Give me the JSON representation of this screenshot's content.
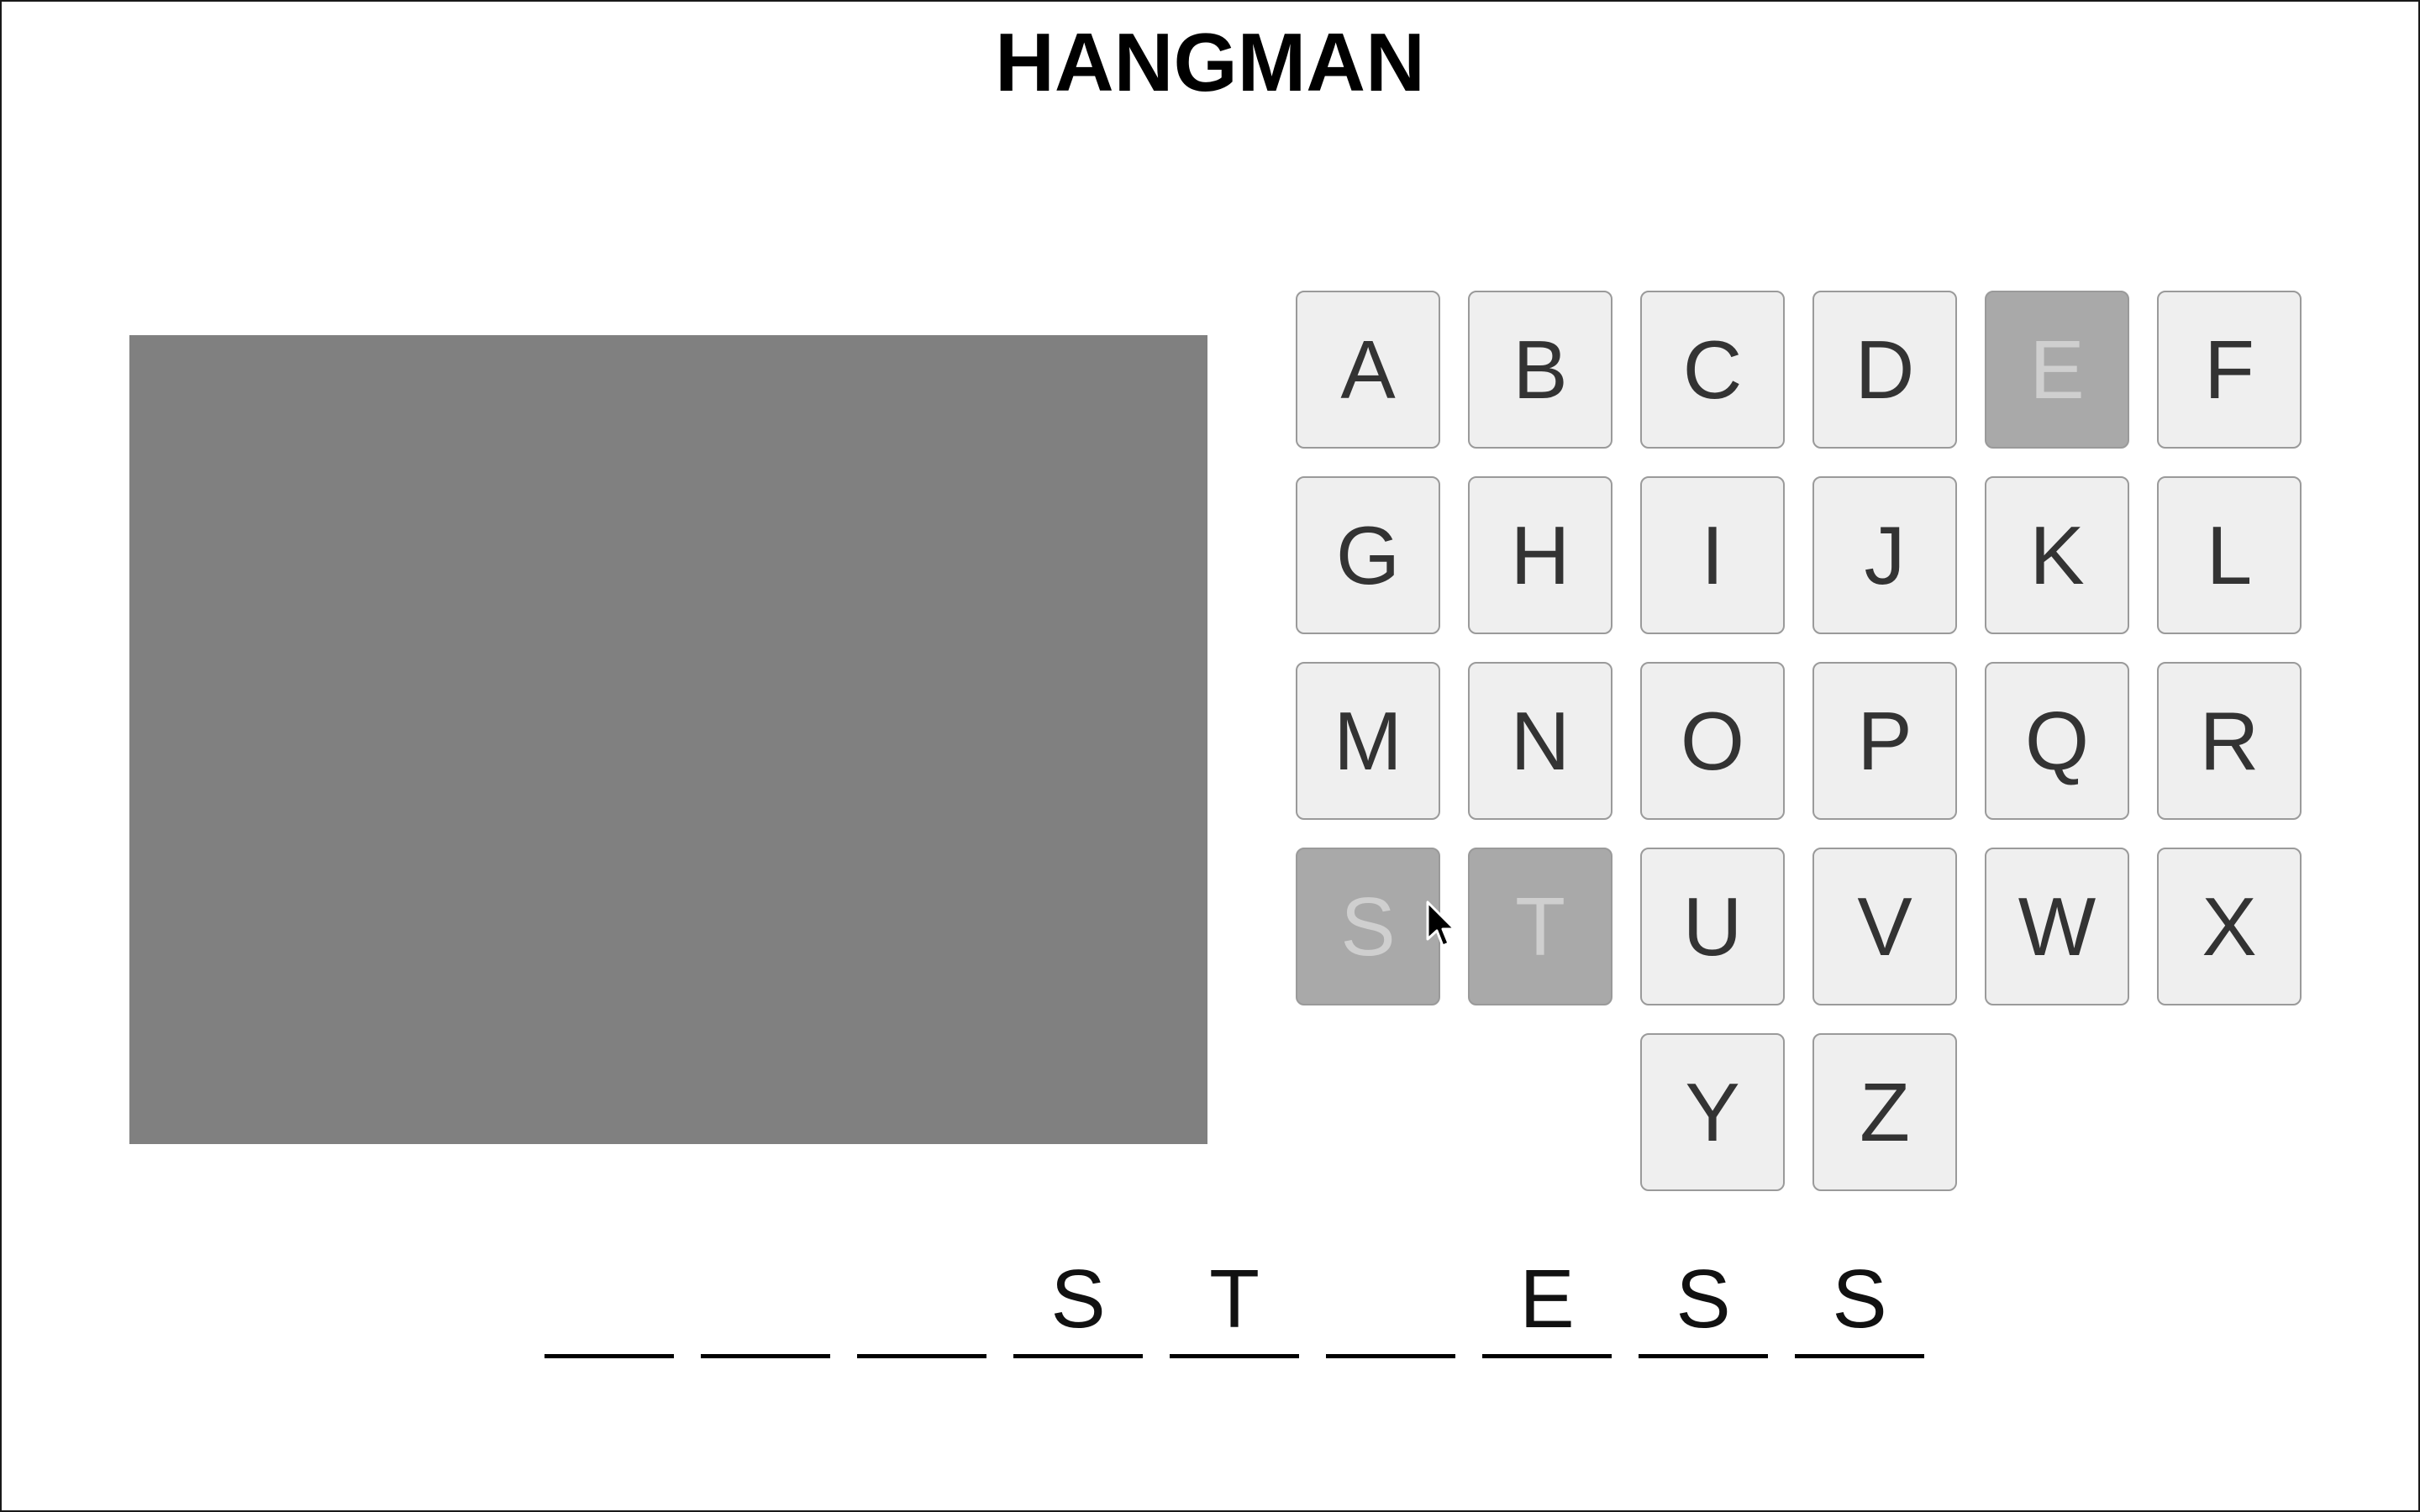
{
  "game": {
    "title": "HANGMAN"
  },
  "keyboard": {
    "keys": [
      {
        "letter": "A",
        "used": false
      },
      {
        "letter": "B",
        "used": false
      },
      {
        "letter": "C",
        "used": false
      },
      {
        "letter": "D",
        "used": false
      },
      {
        "letter": "E",
        "used": true
      },
      {
        "letter": "F",
        "used": false
      },
      {
        "letter": "G",
        "used": false
      },
      {
        "letter": "H",
        "used": false
      },
      {
        "letter": "I",
        "used": false
      },
      {
        "letter": "J",
        "used": false
      },
      {
        "letter": "K",
        "used": false
      },
      {
        "letter": "L",
        "used": false
      },
      {
        "letter": "M",
        "used": false
      },
      {
        "letter": "N",
        "used": false
      },
      {
        "letter": "O",
        "used": false
      },
      {
        "letter": "P",
        "used": false
      },
      {
        "letter": "Q",
        "used": false
      },
      {
        "letter": "R",
        "used": false
      },
      {
        "letter": "S",
        "used": true
      },
      {
        "letter": "T",
        "used": true
      },
      {
        "letter": "U",
        "used": false
      },
      {
        "letter": "V",
        "used": false
      },
      {
        "letter": "W",
        "used": false
      },
      {
        "letter": "X",
        "used": false
      },
      {
        "letter": "Y",
        "used": false
      },
      {
        "letter": "Z",
        "used": false
      }
    ]
  },
  "word": {
    "slots": [
      "",
      "",
      "",
      "S",
      "T",
      "",
      "E",
      "S",
      "S"
    ]
  },
  "colors": {
    "canvas": "#808080",
    "key_background": "#efefef",
    "key_used_background": "#a9a9a9",
    "key_text": "#333333",
    "key_used_text": "#cfcfcf"
  },
  "pointer": {
    "icon": "mouse-pointer-icon"
  }
}
